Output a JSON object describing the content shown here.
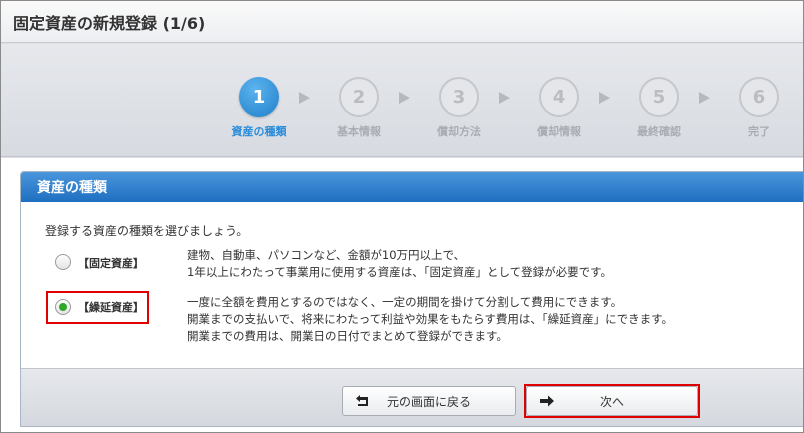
{
  "window": {
    "title": "固定資産の新規登録 (1/6)"
  },
  "steps": [
    {
      "num": "1",
      "label": "資産の種類"
    },
    {
      "num": "2",
      "label": "基本情報"
    },
    {
      "num": "3",
      "label": "償却方法"
    },
    {
      "num": "4",
      "label": "償却情報"
    },
    {
      "num": "5",
      "label": "最終確認"
    },
    {
      "num": "6",
      "label": "完了"
    }
  ],
  "panel": {
    "title": "資産の種類",
    "intro": "登録する資産の種類を選びましょう。",
    "options": [
      {
        "label": "【固定資産】",
        "checked": false,
        "desc": [
          "建物、自動車、パソコンなど、金額が10万円以上で、",
          "1年以上にわたって事業用に使用する資産は、「固定資産」として登録が必要です。"
        ]
      },
      {
        "label": "【繰延資産】",
        "checked": true,
        "desc": [
          "一度に全額を費用とするのではなく、一定の期間を掛けて分割して費用にできます。",
          "開業までの支払いで、将来にわたって利益や効果をもたらす費用は、「繰延資産」にできます。",
          "開業までの費用は、開業日の日付でまとめて登録ができます。"
        ]
      }
    ]
  },
  "buttons": {
    "back": {
      "label": "元の画面に戻る",
      "icon": "return-arrow-icon"
    },
    "next": {
      "label": "次へ",
      "icon": "right-arrow-icon"
    }
  },
  "colors": {
    "accent": "#2a8bd8",
    "panel_header": "#2f7fcc",
    "highlight": "#e00000",
    "radio_checked": "#2fa82a"
  }
}
